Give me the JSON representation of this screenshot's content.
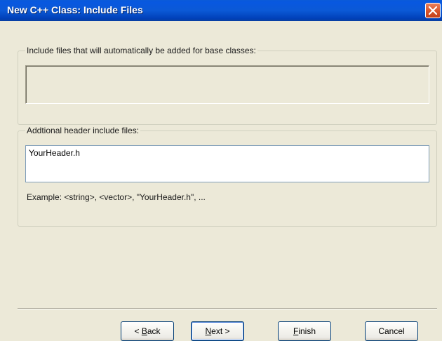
{
  "window": {
    "title": "New C++ Class: Include Files"
  },
  "base_includes": {
    "legend": "Include files that will automatically be added for base classes:",
    "value": ""
  },
  "additional_includes": {
    "legend": "Addtional header include files:",
    "value": "YourHeader.h",
    "example": "Example: <string>, <vector>, \"YourHeader.h\", ..."
  },
  "buttons": {
    "back": {
      "prefix": "< ",
      "mnemonic": "B",
      "suffix": "ack"
    },
    "next": {
      "prefix": "",
      "mnemonic": "N",
      "suffix": "ext >"
    },
    "finish": {
      "prefix": "",
      "mnemonic": "F",
      "suffix": "inish"
    },
    "cancel": {
      "label": "Cancel"
    }
  },
  "icons": {
    "close": "close-icon"
  },
  "colors": {
    "titlebar": "#0b59d6",
    "close_button": "#d8542a",
    "dialog_background": "#ece9d8",
    "button_border": "#003c74"
  }
}
